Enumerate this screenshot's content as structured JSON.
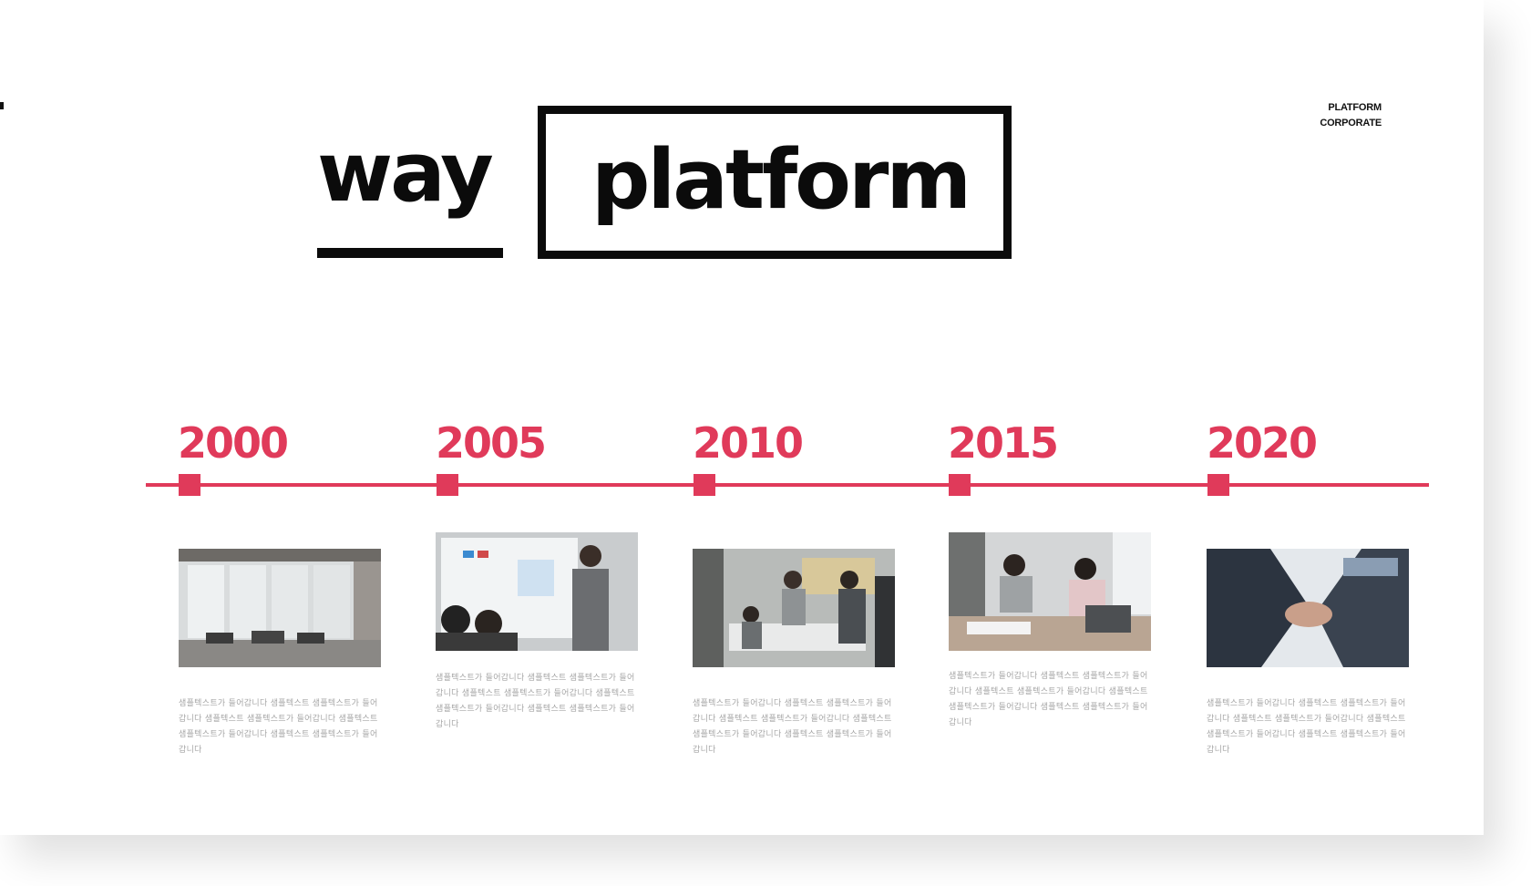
{
  "corner": {
    "line1": "PLATFORM",
    "line2": "CORPORATE"
  },
  "title": {
    "word_left": "way",
    "word_boxed": "platform"
  },
  "colors": {
    "accent": "#e03a5a",
    "ink": "#0b0b0b"
  },
  "timeline": {
    "milestones": [
      {
        "year": "2000",
        "photo": "office-lounge-photo",
        "text": "샘플텍스트가 들어갑니다 샘플텍스트 샘플텍스트가 들어갑니다 샘플텍스트 샘플텍스트가 들어갑니다 샘플텍스트 샘플텍스트가 들어갑니다 샘플텍스트 샘플텍스트가 들어갑니다"
      },
      {
        "year": "2005",
        "photo": "presentation-photo",
        "text": "샘플텍스트가 들어갑니다 샘플텍스트 샘플텍스트가 들어갑니다 샘플텍스트 샘플텍스트가 들어갑니다 샘플텍스트 샘플텍스트가 들어갑니다 샘플텍스트 샘플텍스트가 들어갑니다"
      },
      {
        "year": "2010",
        "photo": "meeting-room-photo",
        "text": "샘플텍스트가 들어갑니다 샘플텍스트 샘플텍스트가 들어갑니다 샘플텍스트 샘플텍스트가 들어갑니다 샘플텍스트 샘플텍스트가 들어갑니다 샘플텍스트 샘플텍스트가 들어갑니다"
      },
      {
        "year": "2015",
        "photo": "team-discussion-photo",
        "text": "샘플텍스트가 들어갑니다 샘플텍스트 샘플텍스트가 들어갑니다 샘플텍스트 샘플텍스트가 들어갑니다 샘플텍스트 샘플텍스트가 들어갑니다 샘플텍스트 샘플텍스트가 들어갑니다"
      },
      {
        "year": "2020",
        "photo": "handshake-photo",
        "text": "샘플텍스트가 들어갑니다 샘플텍스트 샘플텍스트가 들어갑니다 샘플텍스트 샘플텍스트가 들어갑니다 샘플텍스트 샘플텍스트가 들어갑니다 샘플텍스트 샘플텍스트가 들어갑니다"
      }
    ]
  }
}
